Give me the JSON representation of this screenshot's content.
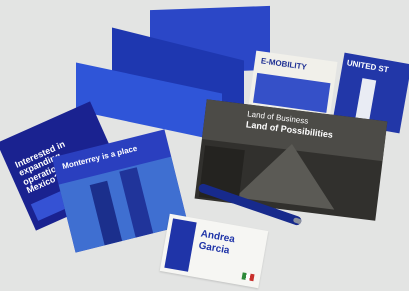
{
  "scene": {
    "items": [
      {
        "name": "folder",
        "text": ""
      },
      {
        "name": "brochure-left",
        "text": "Interested in expanding operations to Mexico?"
      },
      {
        "name": "towers-brochure",
        "text": "Monterrey is a place"
      },
      {
        "name": "mobility-booklet",
        "text": "E-MOBILITY"
      },
      {
        "name": "united-states-booklet",
        "text": "UNITED ST"
      },
      {
        "name": "landcard",
        "title": "Land of Business",
        "subtitle": "Land of Possibilities"
      },
      {
        "name": "business-card",
        "line1": "Andrea",
        "line2": "Garcia"
      }
    ]
  },
  "colors": {
    "background": "#e3e4e3",
    "brand_blue": "#1e37b0",
    "accent_red": "#c8302c"
  }
}
